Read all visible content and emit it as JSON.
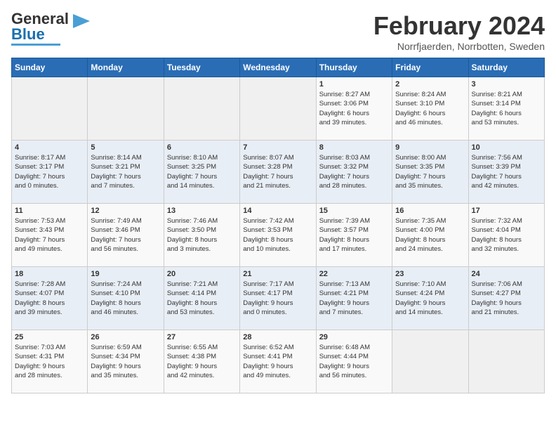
{
  "logo": {
    "part1": "General",
    "part2": "Blue"
  },
  "header": {
    "month_year": "February 2024",
    "location": "Norrfjaerden, Norrbotten, Sweden"
  },
  "weekdays": [
    "Sunday",
    "Monday",
    "Tuesday",
    "Wednesday",
    "Thursday",
    "Friday",
    "Saturday"
  ],
  "weeks": [
    [
      {
        "day": "",
        "info": ""
      },
      {
        "day": "",
        "info": ""
      },
      {
        "day": "",
        "info": ""
      },
      {
        "day": "",
        "info": ""
      },
      {
        "day": "1",
        "info": "Sunrise: 8:27 AM\nSunset: 3:06 PM\nDaylight: 6 hours\nand 39 minutes."
      },
      {
        "day": "2",
        "info": "Sunrise: 8:24 AM\nSunset: 3:10 PM\nDaylight: 6 hours\nand 46 minutes."
      },
      {
        "day": "3",
        "info": "Sunrise: 8:21 AM\nSunset: 3:14 PM\nDaylight: 6 hours\nand 53 minutes."
      }
    ],
    [
      {
        "day": "4",
        "info": "Sunrise: 8:17 AM\nSunset: 3:17 PM\nDaylight: 7 hours\nand 0 minutes."
      },
      {
        "day": "5",
        "info": "Sunrise: 8:14 AM\nSunset: 3:21 PM\nDaylight: 7 hours\nand 7 minutes."
      },
      {
        "day": "6",
        "info": "Sunrise: 8:10 AM\nSunset: 3:25 PM\nDaylight: 7 hours\nand 14 minutes."
      },
      {
        "day": "7",
        "info": "Sunrise: 8:07 AM\nSunset: 3:28 PM\nDaylight: 7 hours\nand 21 minutes."
      },
      {
        "day": "8",
        "info": "Sunrise: 8:03 AM\nSunset: 3:32 PM\nDaylight: 7 hours\nand 28 minutes."
      },
      {
        "day": "9",
        "info": "Sunrise: 8:00 AM\nSunset: 3:35 PM\nDaylight: 7 hours\nand 35 minutes."
      },
      {
        "day": "10",
        "info": "Sunrise: 7:56 AM\nSunset: 3:39 PM\nDaylight: 7 hours\nand 42 minutes."
      }
    ],
    [
      {
        "day": "11",
        "info": "Sunrise: 7:53 AM\nSunset: 3:43 PM\nDaylight: 7 hours\nand 49 minutes."
      },
      {
        "day": "12",
        "info": "Sunrise: 7:49 AM\nSunset: 3:46 PM\nDaylight: 7 hours\nand 56 minutes."
      },
      {
        "day": "13",
        "info": "Sunrise: 7:46 AM\nSunset: 3:50 PM\nDaylight: 8 hours\nand 3 minutes."
      },
      {
        "day": "14",
        "info": "Sunrise: 7:42 AM\nSunset: 3:53 PM\nDaylight: 8 hours\nand 10 minutes."
      },
      {
        "day": "15",
        "info": "Sunrise: 7:39 AM\nSunset: 3:57 PM\nDaylight: 8 hours\nand 17 minutes."
      },
      {
        "day": "16",
        "info": "Sunrise: 7:35 AM\nSunset: 4:00 PM\nDaylight: 8 hours\nand 24 minutes."
      },
      {
        "day": "17",
        "info": "Sunrise: 7:32 AM\nSunset: 4:04 PM\nDaylight: 8 hours\nand 32 minutes."
      }
    ],
    [
      {
        "day": "18",
        "info": "Sunrise: 7:28 AM\nSunset: 4:07 PM\nDaylight: 8 hours\nand 39 minutes."
      },
      {
        "day": "19",
        "info": "Sunrise: 7:24 AM\nSunset: 4:10 PM\nDaylight: 8 hours\nand 46 minutes."
      },
      {
        "day": "20",
        "info": "Sunrise: 7:21 AM\nSunset: 4:14 PM\nDaylight: 8 hours\nand 53 minutes."
      },
      {
        "day": "21",
        "info": "Sunrise: 7:17 AM\nSunset: 4:17 PM\nDaylight: 9 hours\nand 0 minutes."
      },
      {
        "day": "22",
        "info": "Sunrise: 7:13 AM\nSunset: 4:21 PM\nDaylight: 9 hours\nand 7 minutes."
      },
      {
        "day": "23",
        "info": "Sunrise: 7:10 AM\nSunset: 4:24 PM\nDaylight: 9 hours\nand 14 minutes."
      },
      {
        "day": "24",
        "info": "Sunrise: 7:06 AM\nSunset: 4:27 PM\nDaylight: 9 hours\nand 21 minutes."
      }
    ],
    [
      {
        "day": "25",
        "info": "Sunrise: 7:03 AM\nSunset: 4:31 PM\nDaylight: 9 hours\nand 28 minutes."
      },
      {
        "day": "26",
        "info": "Sunrise: 6:59 AM\nSunset: 4:34 PM\nDaylight: 9 hours\nand 35 minutes."
      },
      {
        "day": "27",
        "info": "Sunrise: 6:55 AM\nSunset: 4:38 PM\nDaylight: 9 hours\nand 42 minutes."
      },
      {
        "day": "28",
        "info": "Sunrise: 6:52 AM\nSunset: 4:41 PM\nDaylight: 9 hours\nand 49 minutes."
      },
      {
        "day": "29",
        "info": "Sunrise: 6:48 AM\nSunset: 4:44 PM\nDaylight: 9 hours\nand 56 minutes."
      },
      {
        "day": "",
        "info": ""
      },
      {
        "day": "",
        "info": ""
      }
    ]
  ]
}
